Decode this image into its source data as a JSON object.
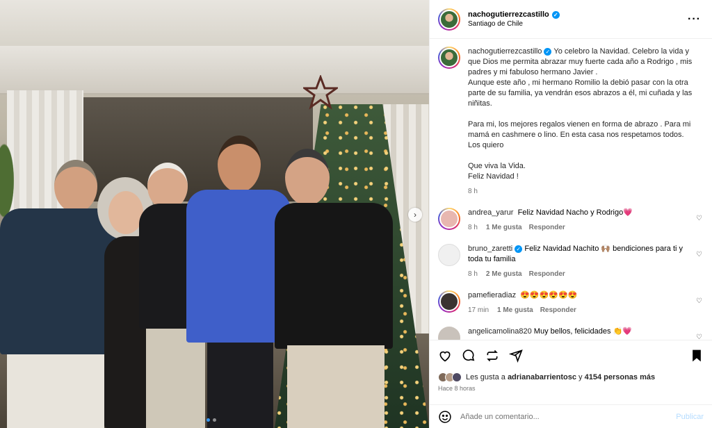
{
  "post": {
    "author": "nachogutierrezcastillo",
    "location": "Santiago de Chile",
    "more_icon": "more-horizontal-icon"
  },
  "caption": {
    "author": "nachogutierrezcastillo",
    "paragraphs": [
      "Yo celebro la Navidad. Celebro la vida y que Dios me permita abrazar muy fuerte cada año a Rodrigo , mis padres y mi fabuloso hermano Javier .\nAunque este año , mi hermano Romilio la debió pasar con la otra parte de su familia, ya vendrán esos abrazos a él, mi cuñada y las niñitas.",
      "Para mi, los mejores regalos vienen en forma de abrazo . Para mi mamá en cashmere o lino. En esta casa nos respetamos todos.\nLos quiero",
      "Que viva la Vida.\nFeliz Navidad !"
    ],
    "time": "8 h"
  },
  "comments": [
    {
      "user": "andrea_yarur",
      "text": "Feliz Navidad Nacho y Rodrigo💗",
      "time": "8 h",
      "likes": "1 Me gusta",
      "reply": "Responder",
      "verified": false,
      "avatar_color": "#e8b7b0"
    },
    {
      "user": "bruno_zaretti",
      "text": "Feliz Navidad Nachito 🙌🏽 bendiciones para ti y toda tu familia",
      "time": "8 h",
      "likes": "2 Me gusta",
      "reply": "Responder",
      "verified": true,
      "avatar_color": "#9a9a9a"
    },
    {
      "user": "pamefieradiaz",
      "text": "😍😍😍😍😍😍",
      "time": "17 min",
      "likes": "1 Me gusta",
      "reply": "Responder",
      "verified": false,
      "avatar_color": "#3a3330"
    },
    {
      "user": "angelicamolina820",
      "text": "Muy bellos, felicidades 👏💗",
      "time": "",
      "likes": "",
      "reply": "",
      "verified": false,
      "avatar_color": "#c9c2bb"
    }
  ],
  "likes": {
    "prefix": "Les gusta a",
    "user": "adrianabarrientosc",
    "conj": "y",
    "others": "4154 personas más"
  },
  "posted_ago": "Hace 8 horas",
  "add_comment": {
    "placeholder": "Añade un comentario...",
    "publish": "Publicar"
  },
  "carousel": {
    "current": 1,
    "total": 2
  }
}
